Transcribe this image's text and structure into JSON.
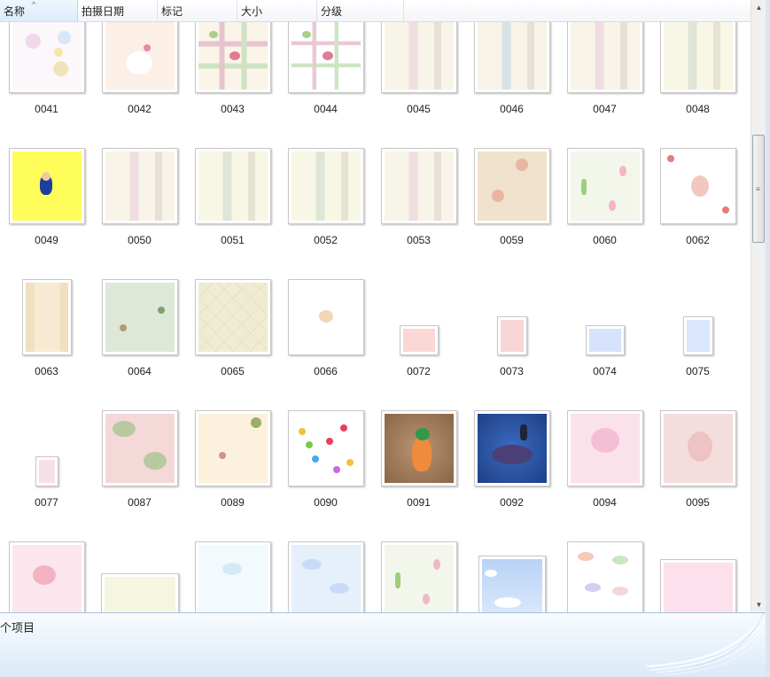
{
  "columns": {
    "name": "名称",
    "date": "拍摄日期",
    "tags": "标记",
    "size": "大小",
    "rating": "分级"
  },
  "items": [
    {
      "name": "0041",
      "style": "floral"
    },
    {
      "name": "0042",
      "style": "kitty"
    },
    {
      "name": "0043",
      "style": "ribbon"
    },
    {
      "name": "0044",
      "style": "ribbon-white"
    },
    {
      "name": "0045",
      "style": "stripe-pink"
    },
    {
      "name": "0046",
      "style": "stripe-blue"
    },
    {
      "name": "0047",
      "style": "stripe-pink"
    },
    {
      "name": "0048",
      "style": "stripe-green"
    },
    {
      "name": "0049",
      "style": "yellow-char"
    },
    {
      "name": "0050",
      "style": "stripe-pink"
    },
    {
      "name": "0051",
      "style": "stripe-green"
    },
    {
      "name": "0052",
      "style": "stripe-green"
    },
    {
      "name": "0053",
      "style": "stripe-pink"
    },
    {
      "name": "0059",
      "style": "beige-floral"
    },
    {
      "name": "0060",
      "style": "tulip"
    },
    {
      "name": "0062",
      "style": "red-char"
    },
    {
      "name": "0063",
      "style": "tall-beige"
    },
    {
      "name": "0064",
      "style": "green-pattern"
    },
    {
      "name": "0065",
      "style": "diamond"
    },
    {
      "name": "0066",
      "style": "bear-white"
    },
    {
      "name": "0072",
      "style": "small-pink"
    },
    {
      "name": "0073",
      "style": "small-pink-tall"
    },
    {
      "name": "0074",
      "style": "small-blue"
    },
    {
      "name": "0075",
      "style": "small-blue-tall"
    },
    {
      "name": "0077",
      "style": "tiny-pink"
    },
    {
      "name": "0087",
      "style": "pink-turtle"
    },
    {
      "name": "0089",
      "style": "cream-pattern"
    },
    {
      "name": "0090",
      "style": "stars"
    },
    {
      "name": "0091",
      "style": "carrot"
    },
    {
      "name": "0092",
      "style": "eggplant"
    },
    {
      "name": "0094",
      "style": "pink-diary"
    },
    {
      "name": "0095",
      "style": "pink-bunny"
    },
    {
      "name": "",
      "style": "pink-bear"
    },
    {
      "name": "",
      "style": "sheep"
    },
    {
      "name": "",
      "style": "light-blue-balloon"
    },
    {
      "name": "",
      "style": "clouds-blue"
    },
    {
      "name": "",
      "style": "tulip"
    },
    {
      "name": "",
      "style": "sky"
    },
    {
      "name": "",
      "style": "clouds-white"
    },
    {
      "name": "",
      "style": "pink-light"
    }
  ],
  "details_pane": {
    "count_text": "个项目"
  },
  "colors": {
    "header_bg": "#f3f5f9",
    "details_bg": "#e9f2fb",
    "selection": "#dcecfc"
  }
}
